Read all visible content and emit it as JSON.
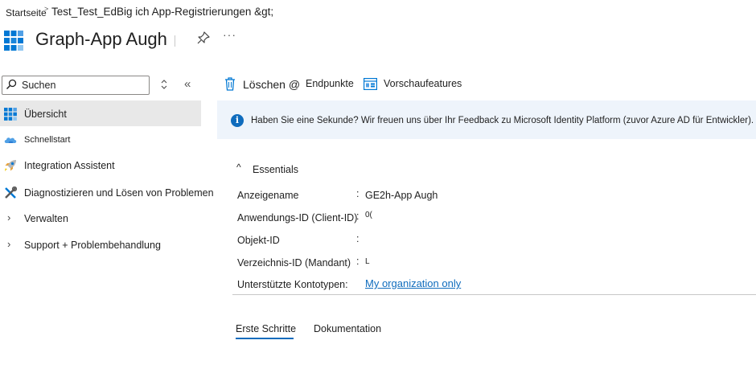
{
  "breadcrumb": {
    "home": "Startseite",
    "separator": ">",
    "path": "Test_Test_EdBig ich App-Registrierungen &gt;"
  },
  "header": {
    "title": "Graph-App Augh",
    "more_label": "···",
    "icons": {
      "app": "app-registration-icon",
      "pin": "pin-icon"
    }
  },
  "sidebar": {
    "search_placeholder": "Suchen",
    "collapse_label": "«",
    "items": [
      {
        "label": "Übersicht",
        "icon": "overview-grid-icon",
        "selected": true
      },
      {
        "label": "Schnellstart",
        "icon": "quickstart-cloud-icon"
      },
      {
        "label": "Integration Assistent",
        "icon": "rocket-icon"
      },
      {
        "label": "Diagnostizieren und Lösen von Problemen",
        "icon": "wrench-icon"
      },
      {
        "label": "Verwalten",
        "icon": "chevron-right-icon"
      },
      {
        "label": "Support + Problembehandlung",
        "icon": "chevron-right-icon"
      }
    ]
  },
  "toolbar": {
    "delete_label": "Löschen @",
    "endpoints_label": "Endpunkte",
    "preview_label": "Vorschaufeatures"
  },
  "banner": {
    "info_glyph": "i",
    "message": "Haben Sie eine Sekunde? Wir freuen uns über Ihr Feedback zu Microsoft Identity Platform (zuvor Azure AD für Entwickler). Ich"
  },
  "essentials": {
    "caret": "^",
    "title": "Essentials",
    "colon": ":",
    "rows": [
      {
        "label": "Anzeigename",
        "value": "GE2h-App Augh"
      },
      {
        "label": "Anwendungs-ID (Client-ID)",
        "value": "0("
      },
      {
        "label": "Objekt-ID",
        "value": ""
      },
      {
        "label": "Verzeichnis-ID (Mandant)",
        "value": "L"
      },
      {
        "label": "Unterstützte Kontotypen:",
        "value": "My organization only",
        "is_link": true
      }
    ]
  },
  "tabs": [
    {
      "label": "Erste Schritte",
      "active": true
    },
    {
      "label": "Dokumentation",
      "active": false
    }
  ],
  "colors": {
    "accent": "#0f6cbd",
    "banner_bg": "#eef4fb",
    "selected_bg": "#e8e8e8"
  }
}
